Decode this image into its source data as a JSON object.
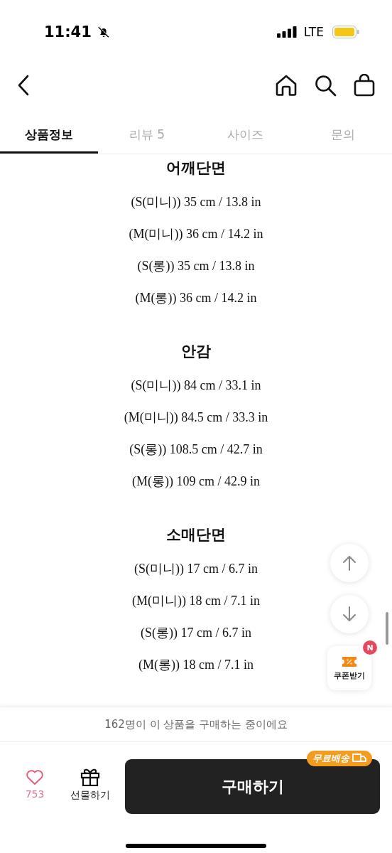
{
  "status_bar": {
    "time": "11:41",
    "network": "LTE"
  },
  "tabs": [
    {
      "label": "상품정보",
      "selected": true
    },
    {
      "label": "리뷰 5",
      "selected": false
    },
    {
      "label": "사이즈",
      "selected": false
    },
    {
      "label": "문의",
      "selected": false
    }
  ],
  "sections": [
    {
      "heading": "어깨단면",
      "rows": [
        "(S(미니)) 35 cm / 13.8 in",
        "(M(미니)) 36 cm / 14.2 in",
        "(S(롱)) 35 cm / 13.8 in",
        "(M(롱)) 36 cm / 14.2 in"
      ]
    },
    {
      "heading": "안감",
      "rows": [
        "(S(미니)) 84 cm / 33.1 in",
        "(M(미니)) 84.5 cm / 33.3 in",
        "(S(롱)) 108.5 cm / 42.7 in",
        "(M(롱)) 109 cm / 42.9 in"
      ]
    },
    {
      "heading": "소매단면",
      "rows": [
        "(S(미니)) 17 cm / 6.7 in",
        "(M(미니)) 18 cm / 7.1 in",
        "(S(롱)) 17 cm / 6.7 in",
        "(M(롱)) 18 cm / 7.1 in"
      ]
    }
  ],
  "coupon": {
    "label": "쿠폰받기",
    "badge": "N"
  },
  "notice": "162명이 이 상품을 구매하는 중이에요",
  "bottom_bar": {
    "like_count": "753",
    "gift_label": "선물하기",
    "buy_label": "구매하기",
    "shipping_badge": "무료배송"
  }
}
